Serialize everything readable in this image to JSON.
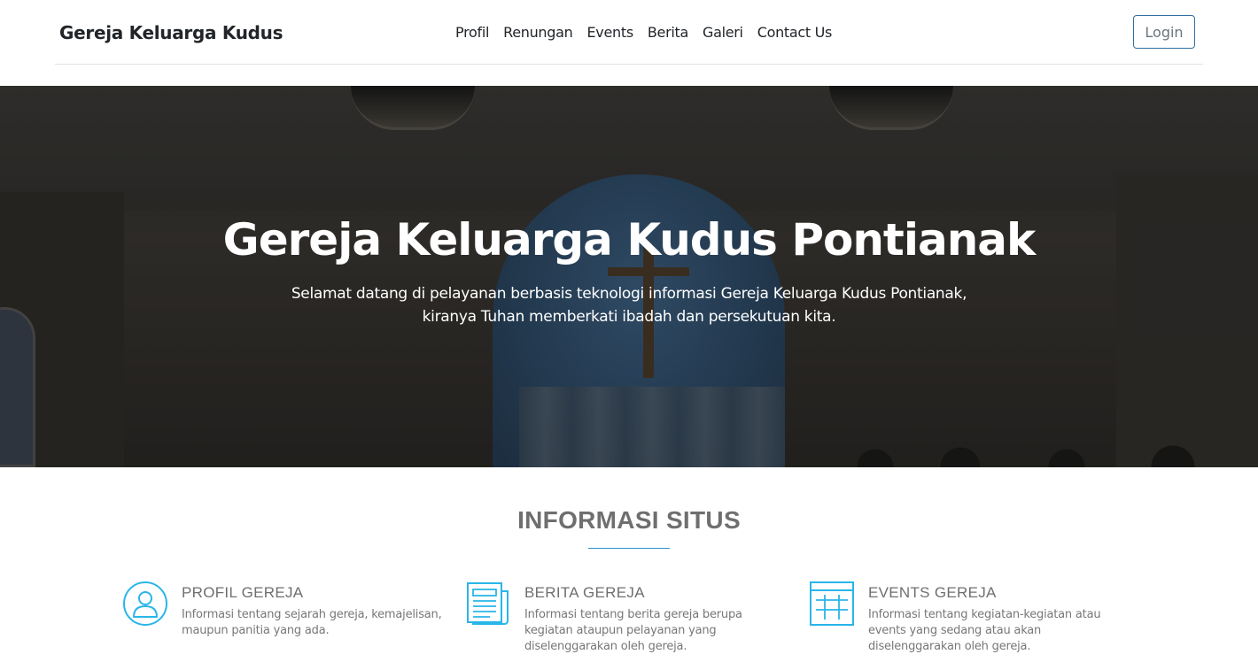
{
  "navbar": {
    "brand": "Gereja Keluarga Kudus",
    "links": [
      "Profil",
      "Renungan",
      "Events",
      "Berita",
      "Galeri",
      "Contact Us"
    ],
    "login_label": "Login"
  },
  "hero": {
    "title": "Gereja Keluarga Kudus Pontianak",
    "subtitle_line1": "Selamat datang di pelayanan berbasis teknologi informasi Gereja Keluarga Kudus Pontianak,",
    "subtitle_line2": "kiranya Tuhan memberkati ibadah dan persekutuan kita."
  },
  "info": {
    "title": "INFORMASI SITUS",
    "cards": [
      {
        "icon": "user-circle-icon",
        "title": "PROFIL GEREJA",
        "desc": "Informasi tentang sejarah gereja, kemajelisan, maupun panitia yang ada."
      },
      {
        "icon": "newspaper-icon",
        "title": "BERITA GEREJA",
        "desc": "Informasi tentang berita gereja berupa kegiatan ataupun pelayanan yang diselenggarakan oleh gereja."
      },
      {
        "icon": "calendar-grid-icon",
        "title": "EVENTS GEREJA",
        "desc": "Informasi tentang kegiatan-kegiatan atau events yang sedang atau akan diselenggarakan oleh gereja."
      }
    ]
  },
  "colors": {
    "accent": "#2a8fd0",
    "icon": "#29b6e8",
    "login_border": "#2f6fa3"
  }
}
